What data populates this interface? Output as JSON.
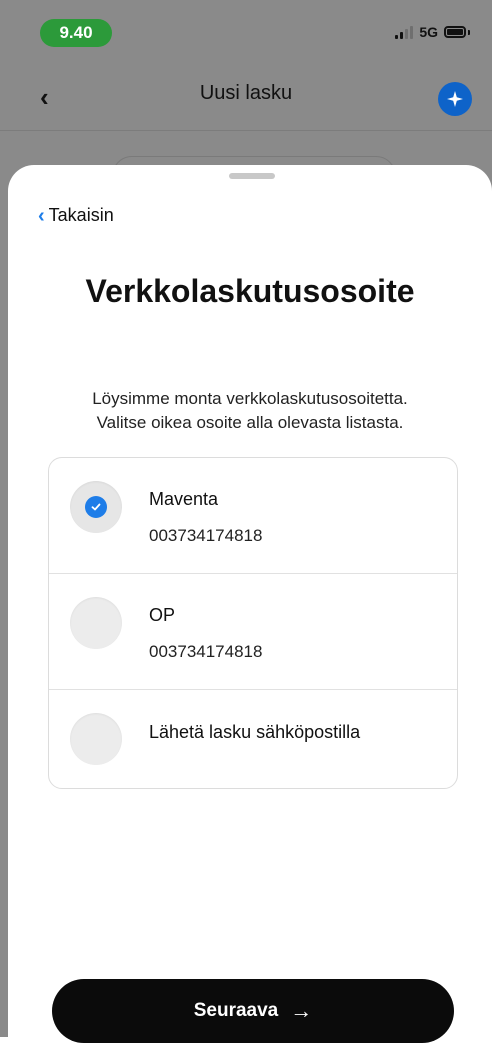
{
  "status_bar": {
    "time": "9.40",
    "network": "5G"
  },
  "background_screen": {
    "back_icon": "chevron-left-icon",
    "title": "Uusi lasku",
    "action_icon": "sparkle-icon",
    "accent_color": "#0e63c9"
  },
  "sheet": {
    "back_label": "Takaisin",
    "title": "Verkkolaskutusosoite",
    "subtitle_line1": "Löysimme monta verkkolaskutusosoitetta.",
    "subtitle_line2": "Valitse oikea osoite alla olevasta listasta.",
    "options": [
      {
        "name": "Maventa",
        "address": "003734174818",
        "selected": true
      },
      {
        "name": "OP",
        "address": "003734174818",
        "selected": false
      },
      {
        "name": "Lähetä lasku sähköpostilla",
        "selected": false
      }
    ],
    "next_label": "Seuraava",
    "accent_color": "#1e7de8",
    "button_color": "#0b0b0b"
  }
}
